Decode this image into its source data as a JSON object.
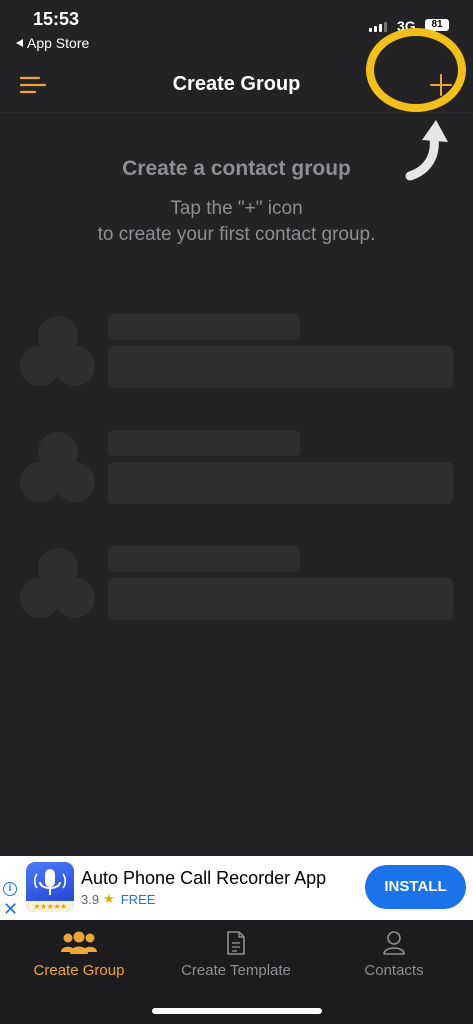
{
  "status_bar": {
    "time": "15:53",
    "back_label": "App Store",
    "network": "3G",
    "battery": "81"
  },
  "nav": {
    "title": "Create Group",
    "menu_icon": "menu-lines-icon",
    "add_icon": "plus-icon",
    "accent_color": "#f0a632"
  },
  "annotation": {
    "highlight_color": "#f2c01a",
    "arrow_color": "#e6e6e6"
  },
  "empty_state": {
    "title": "Create a contact group",
    "line1": "Tap the \"+\" icon",
    "line2": "to create your first contact group."
  },
  "ad": {
    "title": "Auto Phone Call Recorder App",
    "rating": "3.9",
    "price": "FREE",
    "install_label": "INSTALL",
    "icon": "microphone-app-icon"
  },
  "tabs": [
    {
      "label": "Create Group",
      "icon": "group-icon",
      "active": true
    },
    {
      "label": "Create Template",
      "icon": "document-icon",
      "active": false
    },
    {
      "label": "Contacts",
      "icon": "person-icon",
      "active": false
    }
  ]
}
